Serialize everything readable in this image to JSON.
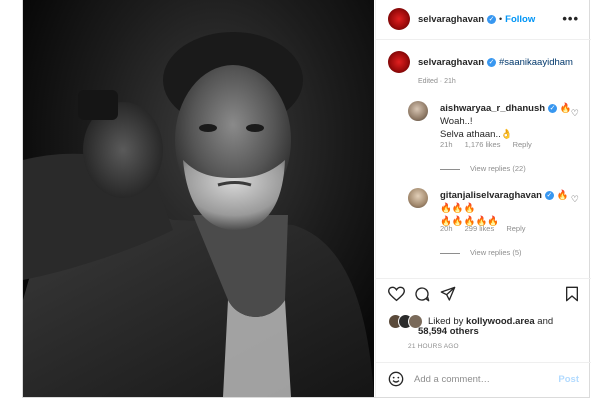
{
  "post": {
    "author": "selvaraghavan",
    "follow_label": "Follow",
    "dot": "•",
    "more_label": "•••",
    "caption": {
      "username": "selvaraghavan",
      "hashtag": "#saanikaayidham",
      "meta": "Edited · 21h"
    },
    "comments": [
      {
        "username": "aishwaryaa_r_dhanush",
        "text_line1": "🔥Woah..!",
        "text_line2": "Selva athaan..👌",
        "time": "21h",
        "likes": "1,176 likes",
        "reply_label": "Reply",
        "view_replies": "View replies (22)"
      },
      {
        "username": "gitanjaliselvaraghavan",
        "text_line1": "🔥🔥🔥🔥",
        "text_line2": "🔥🔥🔥🔥🔥",
        "time": "20h",
        "likes": "299 likes",
        "reply_label": "Reply",
        "view_replies": "View replies (5)"
      }
    ],
    "liked_by_prefix": "Liked by ",
    "liked_by_user": "kollywood.area",
    "liked_by_and": " and",
    "liked_by_count": "58,594 others",
    "timestamp": "21 HOURS AGO",
    "comment_placeholder": "Add a comment…",
    "post_label": "Post"
  },
  "icons": {
    "verified": "✓",
    "heart_small": "♡",
    "emoji": "☺"
  },
  "colors": {
    "follow_blue": "#0095f6",
    "verified_blue": "#3897f0",
    "hashtag_blue": "#00376b"
  }
}
